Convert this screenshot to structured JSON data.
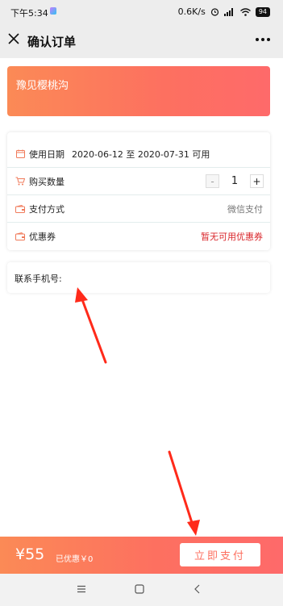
{
  "status_bar": {
    "time": "下午5:34",
    "speed": "0.6K/s",
    "battery": "94"
  },
  "header": {
    "title": "确认订单"
  },
  "product": {
    "name": "豫见樱桃沟"
  },
  "rows": {
    "date": {
      "label": "使用日期",
      "value": "2020-06-12 至 2020-07-31 可用"
    },
    "quantity": {
      "label": "购买数量",
      "minus": "-",
      "value": "1",
      "plus": "+"
    },
    "payment": {
      "label": "支付方式",
      "value": "微信支付"
    },
    "coupon": {
      "label": "优惠券",
      "value": "暂无可用优惠券"
    }
  },
  "contact": {
    "label": "联系手机号:"
  },
  "pay_bar": {
    "price": "¥55",
    "discount": "已优惠￥0",
    "button": "立即支付"
  },
  "colors": {
    "accent_start": "#fb8a56",
    "accent_end": "#fe6a6a",
    "promo": "#d9252a",
    "arrow": "#ff2a1a"
  },
  "icons": [
    "close-icon",
    "more-icon",
    "calendar-icon",
    "cart-icon",
    "wallet-icon",
    "coupon-icon",
    "menu-nav-icon",
    "home-nav-icon",
    "back-nav-icon"
  ]
}
